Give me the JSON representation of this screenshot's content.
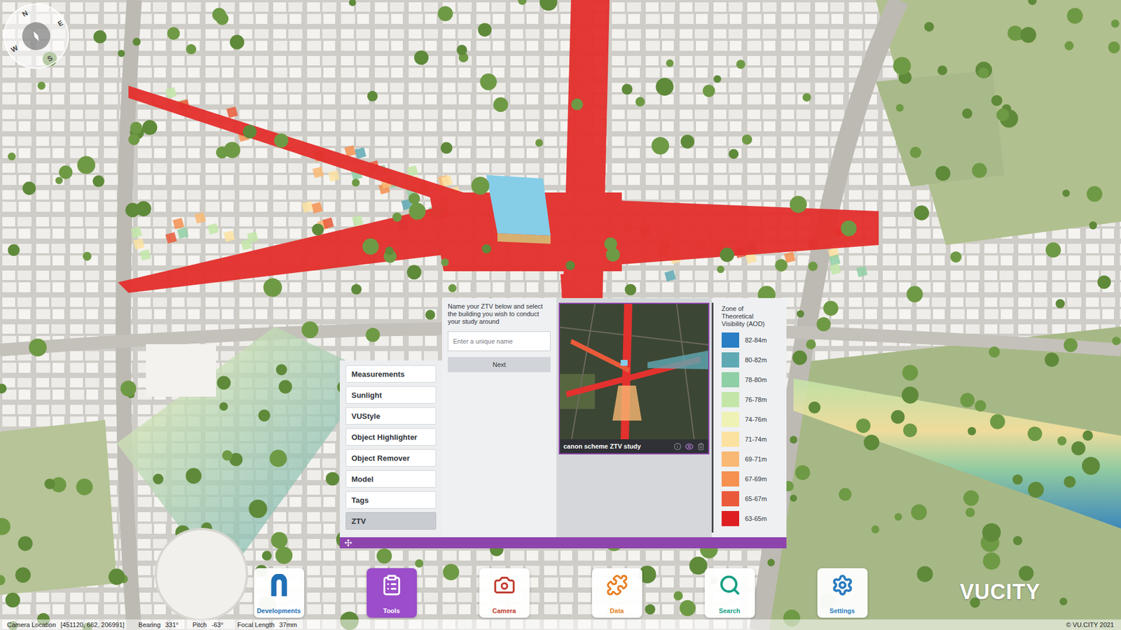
{
  "app": {
    "logo": "VUCITY",
    "copyright": "© VU.CITY 2021"
  },
  "compass": {
    "letters": [
      "N",
      "E",
      "S",
      "W"
    ]
  },
  "tools_menu": [
    {
      "label": "Measurements",
      "selected": false
    },
    {
      "label": "Sunlight",
      "selected": false
    },
    {
      "label": "VUStyle",
      "selected": false
    },
    {
      "label": "Object Highlighter",
      "selected": false
    },
    {
      "label": "Object Remover",
      "selected": false
    },
    {
      "label": "Model",
      "selected": false
    },
    {
      "label": "Tags",
      "selected": false
    },
    {
      "label": "ZTV",
      "selected": true
    }
  ],
  "ztv_form": {
    "instruction": "Name your ZTV below and select the building you wish to conduct your study around",
    "placeholder": "Enter a unique name",
    "button": "Next"
  },
  "studies": [
    {
      "name": "canon scheme ZTV study",
      "visible": true,
      "selected": true
    }
  ],
  "legend": {
    "title": "Zone of Theoretical Visibility (AOD)",
    "bands": [
      {
        "label": "82-84m",
        "color": "#2a7fc4"
      },
      {
        "label": "80-82m",
        "color": "#5fa9b4"
      },
      {
        "label": "78-80m",
        "color": "#8fcfa5"
      },
      {
        "label": "76-78m",
        "color": "#c3e6a8"
      },
      {
        "label": "74-76m",
        "color": "#eef2b4"
      },
      {
        "label": "71-74m",
        "color": "#fbe2a0"
      },
      {
        "label": "69-71m",
        "color": "#f9b873"
      },
      {
        "label": "67-69m",
        "color": "#f59050"
      },
      {
        "label": "65-67m",
        "color": "#ea5a3a"
      },
      {
        "label": "63-65m",
        "color": "#dd1f22"
      }
    ]
  },
  "toolbar": [
    {
      "label": "Developments",
      "selected": false,
      "color": "#1f6fb5"
    },
    {
      "label": "Tools",
      "selected": true,
      "color": "#ffffff"
    },
    {
      "label": "Camera",
      "selected": false,
      "color": "#c0392b"
    },
    {
      "label": "Data",
      "selected": false,
      "color": "#e67e22"
    },
    {
      "label": "Search",
      "selected": false,
      "color": "#16a085"
    },
    {
      "label": "Settings",
      "selected": false,
      "color": "#2b7bc0"
    }
  ],
  "status_bar": [
    {
      "label": "Camera Location",
      "value": "[451120, 662, 206991]"
    },
    {
      "label": "Bearing",
      "value": "331°"
    },
    {
      "label": "Pitch",
      "value": "-63°"
    },
    {
      "label": "Focal Length",
      "value": "37mm"
    }
  ]
}
